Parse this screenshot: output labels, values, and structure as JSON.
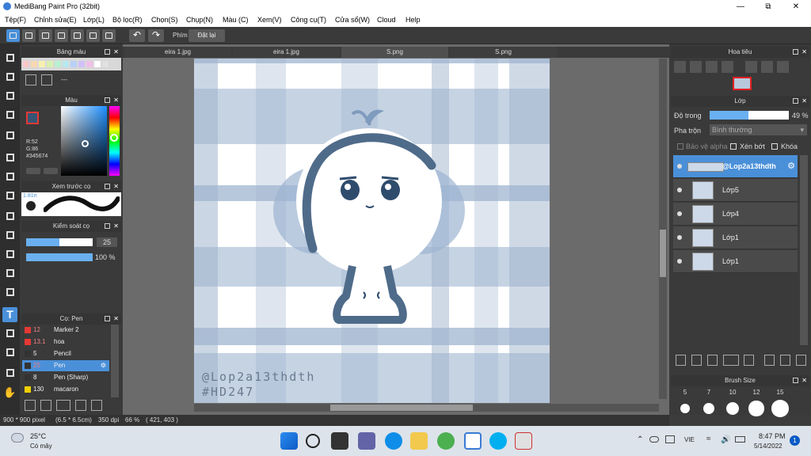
{
  "window": {
    "title": "MediBang Paint Pro (32bit)"
  },
  "menu": [
    "Tệp(F)",
    "Chỉnh sửa(E)",
    "Lớp(L)",
    "Bộ lọc(R)",
    "Chọn(S)",
    "Chụp(N)",
    "Màu (C)",
    "Xem(V)",
    "Công cụ(T)",
    "Cửa sổ(W)",
    "Cloud",
    "Help"
  ],
  "toolbar": {
    "phim_label": "Phím",
    "reset_label": "Đặt lại"
  },
  "panels": {
    "palette": "Bảng màu",
    "palette_value": "---",
    "color": "Màu",
    "color_values": {
      "r": "R:52",
      "g": "G:86",
      "hex": "#345674"
    },
    "brush_preview": "Xem trước cọ",
    "brush_preview_size": "1.81n",
    "brush_control": "Kiểm soát cọ",
    "brush_size_value": "25",
    "brush_opacity_value": "100 %",
    "brush_list_title": "Cọ: Pen",
    "navigator": "Hoa tiêu",
    "layer": "Lớp",
    "opacity_label": "Độ trong",
    "opacity_value": "49 %",
    "blend_label": "Pha trộn",
    "blend_value": "Bình thường",
    "alpha_label": "Bảo vệ alpha",
    "clip_label": "Xén bớt",
    "lock_label": "Khóa",
    "brush_size_panel": "Brush Size"
  },
  "brushes": [
    {
      "size": "12",
      "name": "Marker 2",
      "color": "#e53935"
    },
    {
      "size": "13.1",
      "name": "hoa",
      "color": "#e53935"
    },
    {
      "size": "5",
      "name": "Pencil",
      "color": "#333333"
    },
    {
      "size": "25",
      "name": "Pen",
      "color": "#333333",
      "selected": true
    },
    {
      "size": "8",
      "name": "Pen (Sharp)",
      "color": "#333333"
    },
    {
      "size": "130",
      "name": "macaron",
      "color": "#f0d000"
    }
  ],
  "brush_sizes": [
    "5",
    "7",
    "10",
    "12",
    "15"
  ],
  "tabs": [
    "eira 1.jpg",
    "eira 1.jpg",
    "S.png",
    "S.png"
  ],
  "layers": [
    {
      "name": "@Lop2a13thdth",
      "selected": true
    },
    {
      "name": "Lớp5"
    },
    {
      "name": "Lớp4"
    },
    {
      "name": "Lớp1"
    },
    {
      "name": "Lớp1"
    }
  ],
  "canvas": {
    "watermark1": "@Lop2a13thdth",
    "watermark2": "#HD247"
  },
  "status": {
    "size": "900 * 900 pixel",
    "physical": "(6.5 * 6.5cm)",
    "dpi": "350 dpi",
    "zoom": "66 %",
    "coords": "( 421, 403 )"
  },
  "taskbar": {
    "weather_temp": "25°C",
    "weather_desc": "Có mây",
    "lang": "VIE",
    "time": "8:47 PM",
    "date": "5/14/2022",
    "notif": "1"
  },
  "colors": {
    "accent": "#4a90d9",
    "fg": "#345674",
    "plaid_a": "#b8c8dc",
    "plaid_b": "#d6e2ee"
  }
}
